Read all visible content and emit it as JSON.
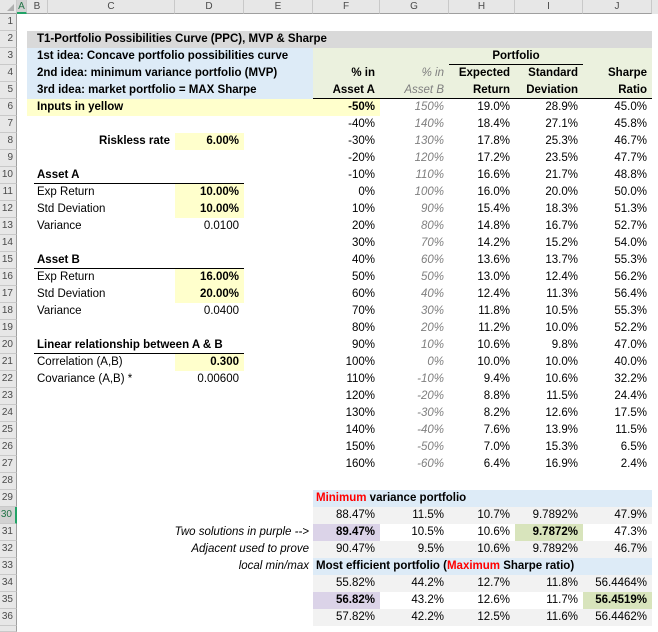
{
  "sheet": {
    "col_headers": [
      "A",
      "B",
      "C",
      "D",
      "E",
      "F",
      "G",
      "H",
      "I",
      "J"
    ],
    "row_headers": [
      "1",
      "2",
      "3",
      "4",
      "5",
      "6",
      "7",
      "8",
      "9",
      "10",
      "11",
      "12",
      "13",
      "14",
      "15",
      "16",
      "17",
      "18",
      "19",
      "20",
      "21",
      "22",
      "23",
      "24",
      "25",
      "26",
      "27",
      "28",
      "29",
      "30",
      "31",
      "32",
      "33",
      "34",
      "35",
      "36"
    ],
    "selection": {
      "col": "A",
      "row": "30"
    }
  },
  "title": "T1-Portfolio Possibilities Curve (PPC), MVP & Sharpe",
  "ideas": [
    "1st idea: Concave portfolio possibilities curve",
    "2nd idea: minimum variance portfolio (MVP)",
    "3rd idea: market portfolio = MAX Sharpe"
  ],
  "inputs_note": "Inputs in yellow",
  "riskless": {
    "label": "Riskless rate",
    "value": "6.00%"
  },
  "asset_a": {
    "title": "Asset A",
    "exp_label": "Exp Return",
    "exp": "10.00%",
    "std_label": "Std Deviation",
    "std": "10.00%",
    "var_label": "Variance",
    "var": "0.0100"
  },
  "asset_b": {
    "title": "Asset B",
    "exp_label": "Exp Return",
    "exp": "16.00%",
    "std_label": "Std Deviation",
    "std": "20.00%",
    "var_label": "Variance",
    "var": "0.0400"
  },
  "linear": {
    "title": "Linear relationship between A & B",
    "corr_label": "Correlation (A,B)",
    "corr": "0.300",
    "cov_label": "Covariance (A,B) *",
    "cov": "0.00600"
  },
  "table": {
    "portfolio": "Portfolio",
    "headers": {
      "f1": "% in",
      "f2": "Asset A",
      "g1": "% in",
      "g2": "Asset B",
      "h1": "Expected",
      "h2": "Return",
      "i1": "Standard",
      "i2": "Deviation",
      "j1": "Sharpe",
      "j2": "Ratio"
    },
    "rows": [
      [
        "-50%",
        "150%",
        "19.0%",
        "28.9%",
        "45.0%"
      ],
      [
        "-40%",
        "140%",
        "18.4%",
        "27.1%",
        "45.8%"
      ],
      [
        "-30%",
        "130%",
        "17.8%",
        "25.3%",
        "46.7%"
      ],
      [
        "-20%",
        "120%",
        "17.2%",
        "23.5%",
        "47.7%"
      ],
      [
        "-10%",
        "110%",
        "16.6%",
        "21.7%",
        "48.8%"
      ],
      [
        "0%",
        "100%",
        "16.0%",
        "20.0%",
        "50.0%"
      ],
      [
        "10%",
        "90%",
        "15.4%",
        "18.3%",
        "51.3%"
      ],
      [
        "20%",
        "80%",
        "14.8%",
        "16.7%",
        "52.7%"
      ],
      [
        "30%",
        "70%",
        "14.2%",
        "15.2%",
        "54.0%"
      ],
      [
        "40%",
        "60%",
        "13.6%",
        "13.7%",
        "55.3%"
      ],
      [
        "50%",
        "50%",
        "13.0%",
        "12.4%",
        "56.2%"
      ],
      [
        "60%",
        "40%",
        "12.4%",
        "11.3%",
        "56.4%"
      ],
      [
        "70%",
        "30%",
        "11.8%",
        "10.5%",
        "55.3%"
      ],
      [
        "80%",
        "20%",
        "11.2%",
        "10.0%",
        "52.2%"
      ],
      [
        "90%",
        "10%",
        "10.6%",
        "9.8%",
        "47.0%"
      ],
      [
        "100%",
        "0%",
        "10.0%",
        "10.0%",
        "40.0%"
      ],
      [
        "110%",
        "-10%",
        "9.4%",
        "10.6%",
        "32.2%"
      ],
      [
        "120%",
        "-20%",
        "8.8%",
        "11.5%",
        "24.4%"
      ],
      [
        "130%",
        "-30%",
        "8.2%",
        "12.6%",
        "17.5%"
      ],
      [
        "140%",
        "-40%",
        "7.6%",
        "13.9%",
        "11.5%"
      ],
      [
        "150%",
        "-50%",
        "7.0%",
        "15.3%",
        "6.5%"
      ],
      [
        "160%",
        "-60%",
        "6.4%",
        "16.9%",
        "2.4%"
      ]
    ]
  },
  "mvp": {
    "title_red": "Minimum",
    "title_rest": " variance portfolio",
    "note1": "Two solutions in purple -->",
    "note2": "Adjacent used to prove",
    "rows": [
      [
        "88.47%",
        "11.5%",
        "10.7%",
        "9.7892%",
        "47.9%"
      ],
      [
        "89.47%",
        "10.5%",
        "10.6%",
        "9.7872%",
        "47.3%"
      ],
      [
        "90.47%",
        "9.5%",
        "10.6%",
        "9.7892%",
        "46.7%"
      ]
    ]
  },
  "mep": {
    "note": "local min/max",
    "title_pre": "Most efficient portfolio (",
    "title_red": "Maximum",
    "title_post": " Sharpe ratio)",
    "rows": [
      [
        "55.82%",
        "44.2%",
        "12.7%",
        "11.8%",
        "56.4464%"
      ],
      [
        "56.82%",
        "43.2%",
        "12.6%",
        "11.7%",
        "56.4519%"
      ],
      [
        "57.82%",
        "42.2%",
        "12.5%",
        "11.6%",
        "56.4462%"
      ]
    ]
  },
  "colors": {
    "input_yellow": "#FFFFCC",
    "band_blue": "#DDEBF7",
    "header_green": "#EBF1DE",
    "row_gray": "#F2F2F2",
    "highlight_purple": "#DBD3E8",
    "highlight_green": "#D8E4BC",
    "title_gray": "#D9D9D9",
    "accent_red": "#FF0000",
    "selection_green": "#21A366"
  }
}
